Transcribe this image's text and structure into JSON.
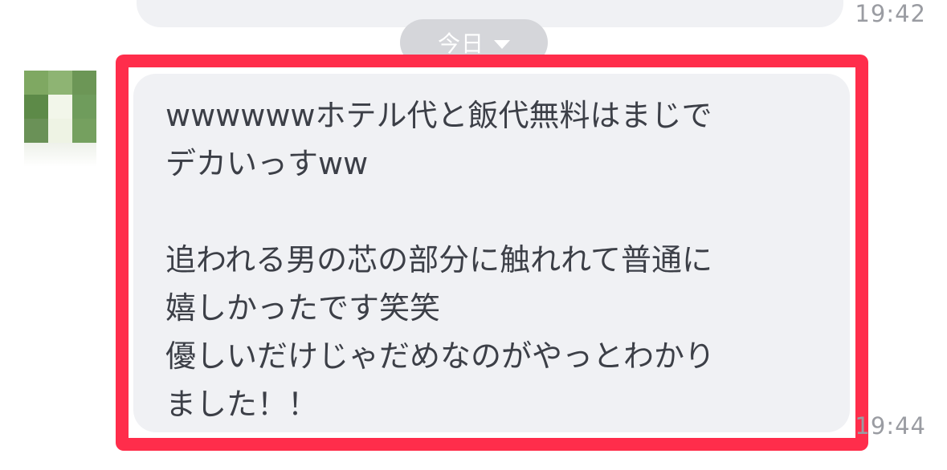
{
  "previous_message": {
    "time": "19:42"
  },
  "date_divider": {
    "label": "今日",
    "icon": "chevron-down-icon"
  },
  "avatar": {
    "pixels": [
      "#7fa862",
      "#8eb473",
      "#6c9656",
      "#5d8a48",
      "#f2f6ea",
      "#6f9c5c",
      "#6a9157",
      "#eef3e4",
      "#75a05f"
    ]
  },
  "message": {
    "lines": [
      "wwwwwwホテル代と飯代無料はまじで",
      "デカいっすww",
      "",
      "追われる男の芯の部分に触れれて普通に",
      "嬉しかったです笑笑",
      "優しいだけじゃだめなのがやっとわかり",
      "ました！！"
    ],
    "time": "19:44"
  },
  "colors": {
    "highlight_border": "#ff2d4b",
    "bubble_bg": "#f0f1f4",
    "text": "#3c3f47",
    "timestamp": "#9a9ca2",
    "date_chip_bg": "#d5d6da"
  }
}
